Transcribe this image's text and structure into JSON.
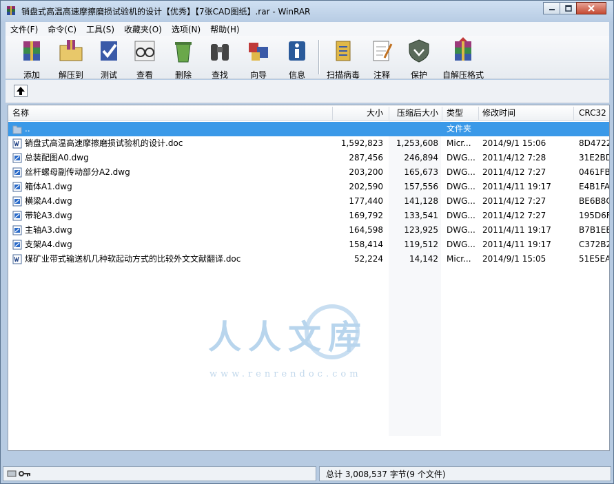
{
  "window": {
    "title": "销盘式高温高速摩擦磨损试验机的设计【优秀】【7张CAD图纸】.rar - WinRAR"
  },
  "menu": [
    "文件(F)",
    "命令(C)",
    "工具(S)",
    "收藏夹(O)",
    "选项(N)",
    "帮助(H)"
  ],
  "toolbar": {
    "add": "添加",
    "extract": "解压到",
    "test": "测试",
    "view": "查看",
    "delete": "删除",
    "find": "查找",
    "wizard": "向导",
    "info": "信息",
    "virus": "扫描病毒",
    "comment": "注释",
    "protect": "保护",
    "sfx": "自解压格式"
  },
  "columns": {
    "name": "名称",
    "size": "大小",
    "packed": "压缩后大小",
    "type": "类型",
    "modified": "修改时间",
    "crc": "CRC32"
  },
  "parent_row": {
    "name": "..",
    "type": "文件夹"
  },
  "files": [
    {
      "name": "销盘式高温高速摩擦磨损试验机的设计.doc",
      "size": "1,592,823",
      "packed": "1,253,608",
      "type": "Micr...",
      "modified": "2014/9/1 15:06",
      "crc": "8D4722"
    },
    {
      "name": "总装配图A0.dwg",
      "size": "287,456",
      "packed": "246,894",
      "type": "DWG...",
      "modified": "2011/4/12 7:28",
      "crc": "31E2BD"
    },
    {
      "name": "丝杆螺母副传动部分A2.dwg",
      "size": "203,200",
      "packed": "165,673",
      "type": "DWG...",
      "modified": "2011/4/12 7:27",
      "crc": "0461FB"
    },
    {
      "name": "箱体A1.dwg",
      "size": "202,590",
      "packed": "157,556",
      "type": "DWG...",
      "modified": "2011/4/11 19:17",
      "crc": "E4B1FA"
    },
    {
      "name": "横梁A4.dwg",
      "size": "177,440",
      "packed": "141,128",
      "type": "DWG...",
      "modified": "2011/4/12 7:27",
      "crc": "BE6B8C"
    },
    {
      "name": "带轮A3.dwg",
      "size": "169,792",
      "packed": "133,541",
      "type": "DWG...",
      "modified": "2011/4/12 7:27",
      "crc": "195D6F"
    },
    {
      "name": "主轴A3.dwg",
      "size": "164,598",
      "packed": "123,925",
      "type": "DWG...",
      "modified": "2011/4/11 19:17",
      "crc": "B7B1EB"
    },
    {
      "name": "支架A4.dwg",
      "size": "158,414",
      "packed": "119,512",
      "type": "DWG...",
      "modified": "2011/4/11 19:17",
      "crc": "C372B2"
    },
    {
      "name": "煤矿业带式输送机几种软起动方式的比较外文文献翻译.doc",
      "size": "52,224",
      "packed": "14,142",
      "type": "Micr...",
      "modified": "2014/9/1 15:05",
      "crc": "51E5EA"
    }
  ],
  "status": {
    "total": "总计 3,008,537 字节(9 个文件)"
  },
  "watermark": {
    "chars": "人人文库",
    "url": "www.renrendoc.com"
  }
}
